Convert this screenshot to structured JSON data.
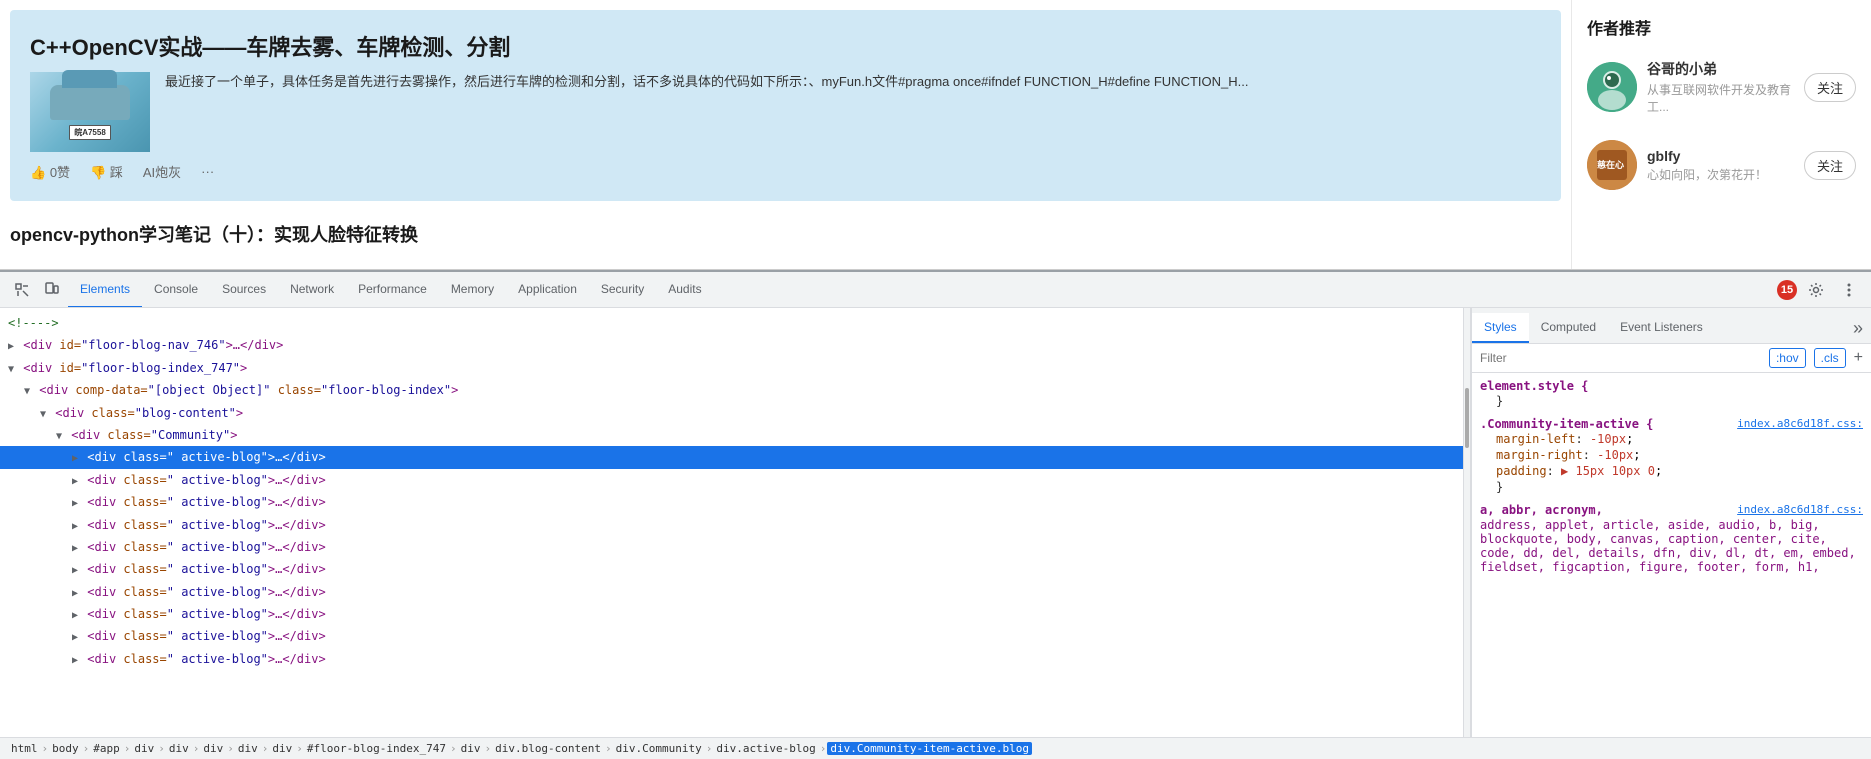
{
  "website": {
    "article1": {
      "title": "C++OpenCV实战——车牌去雾、车牌检测、分割",
      "excerpt": "最近接了一个单子，具体任务是首先进行去雾操作，然后进行车牌的检测和分割，话不多说具体的代码如下所示：、myFun.h文件#pragma once#ifndef FUNCTION_H#define FUNCTION_H...",
      "likes": "0赞",
      "dislikes": "踩",
      "ai": "AI炮灰",
      "more": "···",
      "plate_text": "皖A7558"
    },
    "article2": {
      "title": "opencv-python学习笔记（十）：实现人脸特征转换"
    }
  },
  "sidebar": {
    "title": "作者推荐",
    "authors": [
      {
        "name": "谷哥的小弟",
        "desc": "从事互联网软件开发及教育工...",
        "follow": "关注"
      },
      {
        "name": "gblfy",
        "desc": "心如向阳，次第花开！",
        "follow": "关注"
      }
    ]
  },
  "devtools": {
    "tabs": [
      {
        "label": "Elements",
        "active": true
      },
      {
        "label": "Console",
        "active": false
      },
      {
        "label": "Sources",
        "active": false
      },
      {
        "label": "Network",
        "active": false
      },
      {
        "label": "Performance",
        "active": false
      },
      {
        "label": "Memory",
        "active": false
      },
      {
        "label": "Application",
        "active": false
      },
      {
        "label": "Security",
        "active": false
      },
      {
        "label": "Audits",
        "active": false
      }
    ],
    "error_count": "15",
    "dom": [
      {
        "indent": 0,
        "content": "<!---->",
        "type": "comment",
        "selected": false
      },
      {
        "indent": 0,
        "content": "<div id=\"floor-blog-nav_746\">…</div>",
        "type": "element",
        "selected": false
      },
      {
        "indent": 0,
        "content": "<div id=\"floor-blog-index_747\">",
        "type": "element",
        "selected": false
      },
      {
        "indent": 1,
        "content": "<div comp-data=\"[object Object]\" class=\"floor-blog-index\">",
        "type": "element",
        "selected": false
      },
      {
        "indent": 2,
        "content": "<div class=\"blog-content\">",
        "type": "element",
        "selected": false
      },
      {
        "indent": 3,
        "content": "<div class=\"Community\">",
        "type": "element",
        "selected": false
      },
      {
        "indent": 4,
        "content": "<div class=\" active-blog\">…</div>",
        "type": "element",
        "selected": true
      },
      {
        "indent": 4,
        "content": "<div class=\" active-blog\">…</div>",
        "type": "element",
        "selected": false
      },
      {
        "indent": 4,
        "content": "<div class=\" active-blog\">…</div>",
        "type": "element",
        "selected": false
      },
      {
        "indent": 4,
        "content": "<div class=\" active-blog\">…</div>",
        "type": "element",
        "selected": false
      },
      {
        "indent": 4,
        "content": "<div class=\" active-blog\">…</div>",
        "type": "element",
        "selected": false
      },
      {
        "indent": 4,
        "content": "<div class=\" active-blog\">…</div>",
        "type": "element",
        "selected": false
      },
      {
        "indent": 4,
        "content": "<div class=\" active-blog\">…</div>",
        "type": "element",
        "selected": false
      },
      {
        "indent": 4,
        "content": "<div class=\" active-blog\">…</div>",
        "type": "element",
        "selected": false
      },
      {
        "indent": 4,
        "content": "<div class=\" active-blog\">…</div>",
        "type": "element",
        "selected": false
      }
    ],
    "styles": {
      "tabs": [
        "Styles",
        "Computed",
        "Event Listeners"
      ],
      "filter_placeholder": "Filter",
      "pseudo": ":hov",
      "cls": ".cls",
      "rules": [
        {
          "selector": "element.style {",
          "close": "}",
          "props": []
        },
        {
          "selector": ".Community-item-active {",
          "source": "index.a8c6d18f.css:",
          "close": "}",
          "props": [
            {
              "name": "margin-left",
              "value": "-10px",
              "color": "red"
            },
            {
              "name": "margin-right",
              "value": "-10px",
              "color": "red"
            },
            {
              "name": "padding",
              "value": "▶ 15px 10px 0",
              "color": "red"
            }
          ]
        },
        {
          "selector": "a, abbr, acronym,",
          "source": "index.a8c6d18f.css:",
          "extra": "address, applet, article, aside, audio, b, big, blockquote, body, canvas, caption, center, cite, code, dd, del, details, dfn, div, dl, dt, em, embed, fieldset, figcaption, figure, footer, form, h1,",
          "props": []
        }
      ]
    },
    "breadcrumb": [
      "html",
      "body",
      "#app",
      "div",
      "div",
      "div",
      "div",
      "div",
      "#floor-blog-index_747",
      "div",
      "div.blog-content",
      "div.Community",
      "div.active-blog",
      "div.Community-item-active.blog"
    ]
  }
}
